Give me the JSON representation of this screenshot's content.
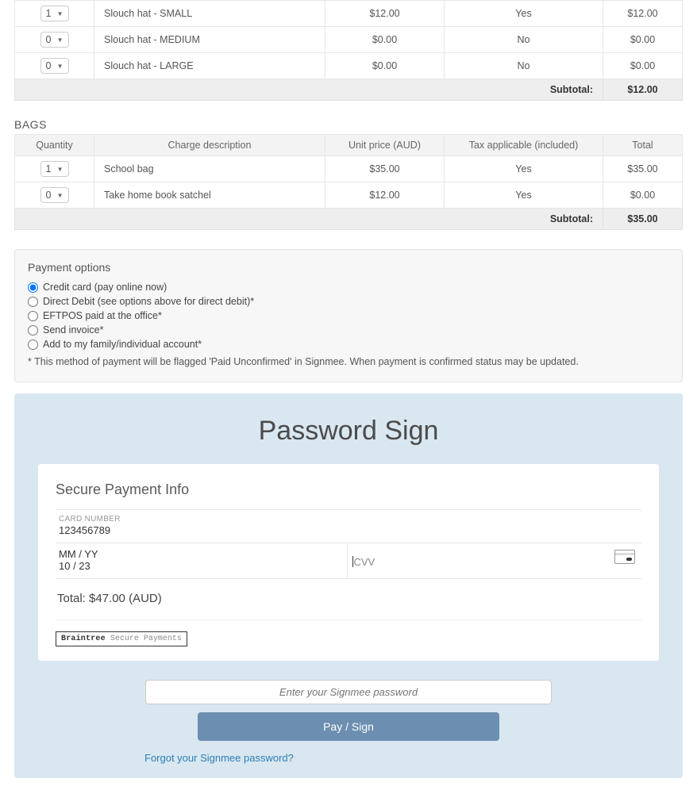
{
  "hats": {
    "rows": [
      {
        "qty": "1",
        "desc": "Slouch hat - SMALL",
        "unit": "$12.00",
        "tax": "Yes",
        "total": "$12.00"
      },
      {
        "qty": "0",
        "desc": "Slouch hat - MEDIUM",
        "unit": "$0.00",
        "tax": "No",
        "total": "$0.00"
      },
      {
        "qty": "0",
        "desc": "Slouch hat - LARGE",
        "unit": "$0.00",
        "tax": "No",
        "total": "$0.00"
      }
    ],
    "subtotal_label": "Subtotal:",
    "subtotal_value": "$12.00"
  },
  "bags": {
    "title": "BAGS",
    "headers": {
      "qty": "Quantity",
      "desc": "Charge description",
      "unit": "Unit price (AUD)",
      "tax": "Tax applicable (included)",
      "total": "Total"
    },
    "rows": [
      {
        "qty": "1",
        "desc": "School bag",
        "unit": "$35.00",
        "tax": "Yes",
        "total": "$35.00"
      },
      {
        "qty": "0",
        "desc": "Take home book satchel",
        "unit": "$12.00",
        "tax": "Yes",
        "total": "$0.00"
      }
    ],
    "subtotal_label": "Subtotal:",
    "subtotal_value": "$35.00"
  },
  "payment": {
    "title": "Payment options",
    "options": [
      "Credit card (pay online now)",
      "Direct Debit (see options above for direct debit)*",
      "EFTPOS paid at the office*",
      "Send invoice*",
      "Add to my family/individual account*"
    ],
    "note": "* This method of payment will be flagged 'Paid Unconfirmed' in Signmee. When payment is confirmed status may be updated."
  },
  "sign": {
    "heading": "Password Sign",
    "secure_title": "Secure Payment Info",
    "card_label": "Card Number",
    "card_value": "123456789",
    "exp_label": "MM / YY",
    "exp_value": "10 / 23",
    "cvv_placeholder": "CVV",
    "total_text": "Total: $47.00  (AUD)",
    "braintree_brand": "Braintree",
    "braintree_tag": "Secure Payments",
    "password_placeholder": "Enter your Signmee password",
    "pay_button": "Pay / Sign",
    "forgot": "Forgot your Signmee password?"
  }
}
